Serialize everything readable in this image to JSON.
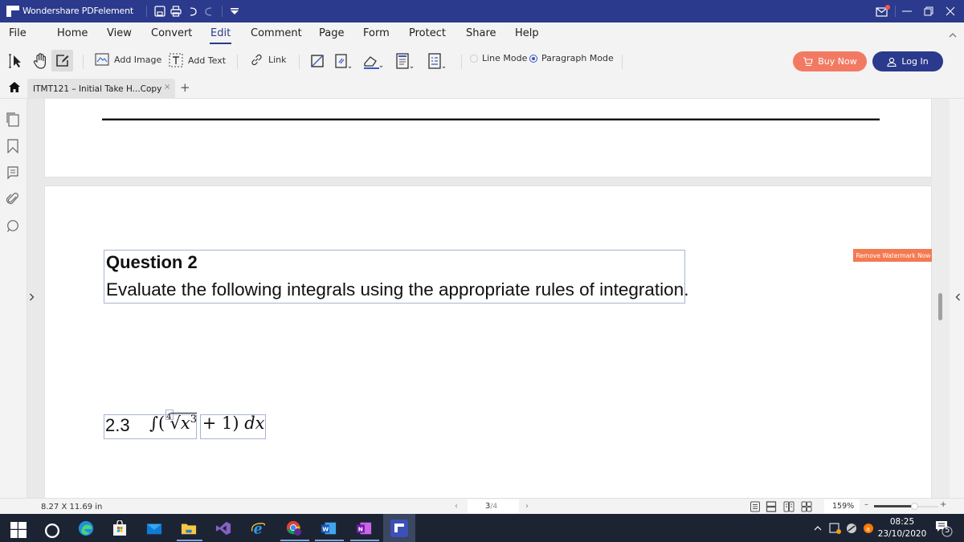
{
  "window": {
    "app_title": "Wondershare PDFelement",
    "quick_access": [
      "save-icon",
      "print-icon",
      "undo-icon",
      "redo-icon",
      "customize-dropdown-icon"
    ],
    "controls": [
      "mail-icon",
      "minimize-icon",
      "restore-icon",
      "close-icon"
    ],
    "mail_badge_color": "#f2564a"
  },
  "menu": {
    "items": [
      {
        "label": "File"
      },
      {
        "label": "Home"
      },
      {
        "label": "View"
      },
      {
        "label": "Convert"
      },
      {
        "label": "Edit",
        "active": true
      },
      {
        "label": "Comment"
      },
      {
        "label": "Page"
      },
      {
        "label": "Form"
      },
      {
        "label": "Protect"
      },
      {
        "label": "Share"
      },
      {
        "label": "Help"
      }
    ]
  },
  "toolbar": {
    "add_image": "Add Image",
    "add_text": "Add Text",
    "link": "Link",
    "line_mode": "Line Mode",
    "paragraph_mode": "Paragraph Mode",
    "mode_selected": "Paragraph Mode",
    "buy_now": "Buy Now",
    "log_in": "Log In",
    "buy_color": "#f27a63",
    "brand_color": "#2b3a8c"
  },
  "tabs": {
    "items": [
      {
        "label": "ITMT121 – Initial Take H...Copy"
      }
    ],
    "close": "×",
    "add": "+"
  },
  "sidebar": {
    "icons": [
      "thumbnails-icon",
      "bookmark-icon",
      "comment-icon",
      "attachment-icon",
      "search-icon"
    ]
  },
  "document": {
    "question_title": "Question 2",
    "question_text": "Evaluate the following integrals using the appropriate rules of integration.",
    "item_number": "2.3",
    "integral_sign": "∫(",
    "root_index": "4",
    "radical": "√",
    "radicand": "x",
    "exponent": "3",
    "tail": " + 1) ",
    "differential": "dx",
    "watermark_button": "Remove Watermark Now",
    "watermark_color": "#f47950"
  },
  "statusbar": {
    "page_size": "8.27 X 11.69 in",
    "current_page": "3",
    "total_pages": "/4",
    "zoom": "159%",
    "zoom_level_fraction": 0.62,
    "prev": "‹",
    "next": "›",
    "minus": "–",
    "plus": "+"
  },
  "taskbar": {
    "apps": [
      "windows-start-icon",
      "cortana-icon",
      "edge-icon",
      "store-icon",
      "mail-app-icon",
      "file-explorer-icon",
      "visual-studio-icon",
      "internet-explorer-icon",
      "chrome-icon",
      "word-icon",
      "onenote-icon",
      "pdfelement-icon"
    ],
    "time": "08:25",
    "date": "23/10/2020",
    "notifications": "5"
  }
}
